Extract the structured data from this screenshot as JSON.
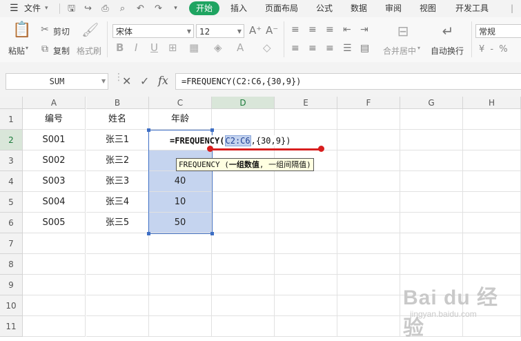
{
  "menu": {
    "file": "文件",
    "tabs": [
      "开始",
      "插入",
      "页面布局",
      "公式",
      "数据",
      "审阅",
      "视图",
      "开发工具"
    ]
  },
  "ribbon": {
    "paste": "粘贴",
    "cut": "剪切",
    "copy": "复制",
    "format_painter": "格式刷",
    "font_name": "宋体",
    "font_size": "12",
    "merge_center": "合并居中",
    "wrap_text": "自动换行",
    "number_format": "常规",
    "number_symbols": "¥ - %"
  },
  "formula_bar": {
    "name_box": "SUM",
    "fx": "fx",
    "formula": "=FREQUENCY(C2:C6,{30,9})"
  },
  "sheet": {
    "columns": [
      "A",
      "B",
      "C",
      "D",
      "E",
      "F",
      "G",
      "H"
    ],
    "rows": [
      "1",
      "2",
      "3",
      "4",
      "5",
      "6",
      "7",
      "8",
      "9",
      "10",
      "11"
    ],
    "header_row": [
      "编号",
      "姓名",
      "年龄"
    ],
    "data": [
      [
        "S001",
        "张三1",
        ""
      ],
      [
        "S002",
        "张三2",
        ""
      ],
      [
        "S003",
        "张三3",
        "40"
      ],
      [
        "S004",
        "张三4",
        "10"
      ],
      [
        "S005",
        "张三5",
        "50"
      ]
    ]
  },
  "editing": {
    "prefix": "=",
    "func": "FREQUENCY",
    "open": "(",
    "ref": "C2:C6",
    "rest": ",{30,9})"
  },
  "tooltip": {
    "func": "FREQUENCY",
    "open": " (",
    "arg1": "一组数值",
    "sep": ", ",
    "arg2": "一组间隔值",
    "close": ")"
  },
  "watermark": {
    "brand": "Bai du 经验",
    "url": "jingyan.baidu.com"
  },
  "colors": {
    "tab_active": "#1fa461",
    "selection": "#c5d4ef",
    "annotation": "#d81e1e"
  }
}
